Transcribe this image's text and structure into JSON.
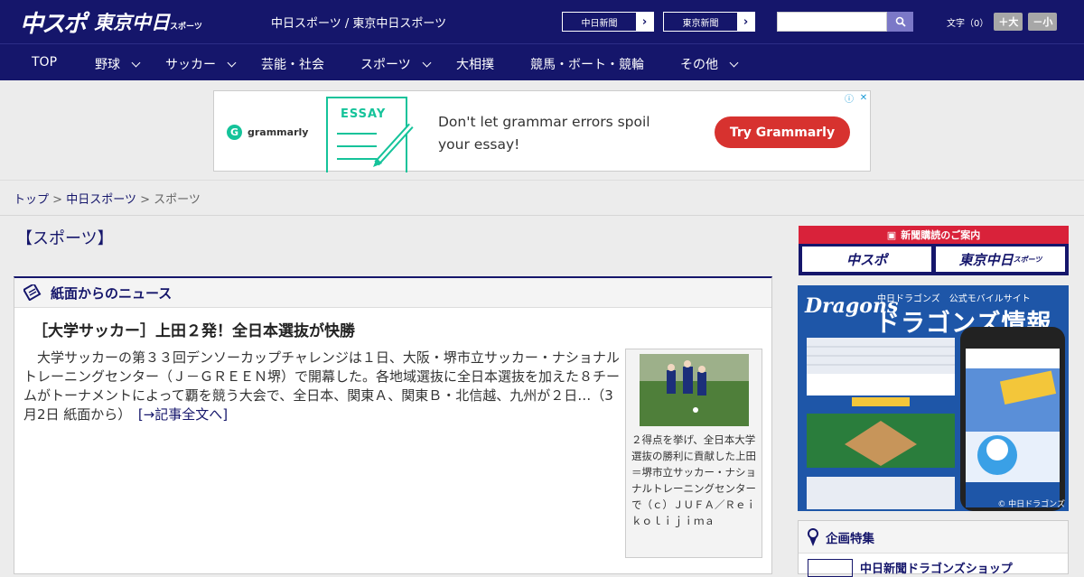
{
  "header": {
    "logo_main": "中スポ",
    "logo_tokyo": "東京中日",
    "logo_tokyo_small": "スポーツ",
    "site_name": "中日スポーツ / 東京中日スポーツ",
    "paper_links": [
      {
        "label": "中日新聞",
        "arrow": "›"
      },
      {
        "label": "東京新聞",
        "arrow": "›"
      }
    ],
    "search_placeholder": "",
    "font_label": "文字（0）",
    "font_plus": "＋大",
    "font_minus": "－小"
  },
  "nav": {
    "items": [
      {
        "label": "TOP",
        "dropdown": false
      },
      {
        "label": "野球",
        "dropdown": true
      },
      {
        "label": "サッカー",
        "dropdown": true
      },
      {
        "label": "芸能・社会",
        "dropdown": false
      },
      {
        "label": "スポーツ",
        "dropdown": true
      },
      {
        "label": "大相撲",
        "dropdown": false
      },
      {
        "label": "競馬・ボート・競輪",
        "dropdown": false
      },
      {
        "label": "その他",
        "dropdown": true
      }
    ]
  },
  "ad": {
    "brand": "grammarly",
    "badge": "ESSAY",
    "text": "Don't let grammar errors spoil your essay!",
    "cta": "Try Grammarly",
    "choices_icon": "ⓘ",
    "close_icon": "✕"
  },
  "breadcrumb": {
    "items": [
      "トップ",
      "中日スポーツ",
      "スポーツ"
    ],
    "separator": ">"
  },
  "page_title": "【スポーツ】",
  "main": {
    "section_title": "紙面からのニュース",
    "article": {
      "title": "［大学サッカー］上田２発！全日本選抜が快勝",
      "body": "大学サッカーの第３３回デンソーカップチャレンジは１日、大阪・堺市立サッカー・ナショナルトレーニングセンター（Ｊ－ＧＲＥＥＮ堺）で開幕した。各地域選抜に全日本選抜を加えた８チームがトーナメントによって覇を競う大会で、全日本、関東Ａ、関東Ｂ・北信越、九州が２日…（3月2日 紙面から）",
      "more": "[→記事全文へ]",
      "caption": "２得点を挙げ、全日本大学選抜の勝利に貢献した上田＝堺市立サッカー・ナショナルトレーニングセンターで（ｃ）ＪＵＦＡ／Ｒｅｉｋｏｌｉｊｉｍａ"
    }
  },
  "sidebar": {
    "subscribe_head": "新聞購読のご案内",
    "subscribe_buttons": [
      "中スポ",
      "東京中日"
    ],
    "subscribe_small": "スポーツ",
    "dragons": {
      "logo": "Dragons",
      "sub": "中日ドラゴンズ　公式モバイルサイト",
      "main": "ドラゴンズ情報",
      "copyright": "© 中日ドラゴンズ"
    },
    "feature_title": "企画特集",
    "feature_item": "中日新聞ドラゴンズショップ"
  },
  "colors": {
    "navy": "#15166b",
    "accent_red": "#d9223a",
    "grammarly_green": "#15c39a"
  }
}
